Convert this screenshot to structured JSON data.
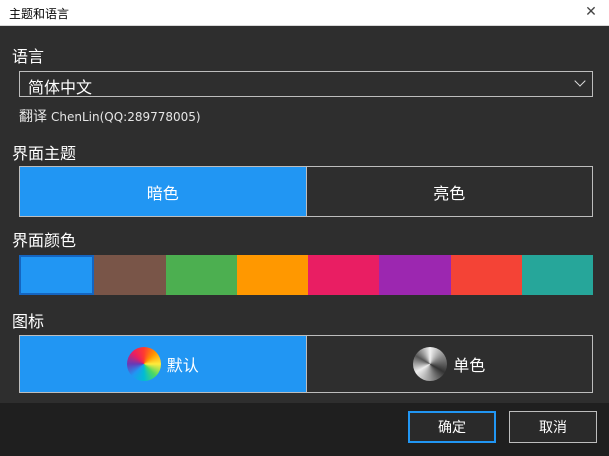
{
  "window": {
    "title": "主题和语言",
    "close": "✕"
  },
  "language": {
    "label": "语言",
    "selected": "简体中文",
    "translator_prefix": "翻译",
    "translator": "ChenLin(QQ:289778005)"
  },
  "theme": {
    "label": "界面主题",
    "options": [
      "暗色",
      "亮色"
    ],
    "selected_index": 0
  },
  "color": {
    "label": "界面颜色",
    "swatches": [
      "#2196f3",
      "#795548",
      "#4caf50",
      "#ff9800",
      "#e91e63",
      "#9c27b0",
      "#f44336",
      "#26a69a"
    ],
    "selected_index": 0
  },
  "icon": {
    "label": "图标",
    "options": [
      "默认",
      "单色"
    ],
    "selected_index": 0,
    "option_icons": [
      "color-wheel-icon",
      "mono-wheel-icon"
    ]
  },
  "footer": {
    "ok": "确定",
    "cancel": "取消"
  },
  "colors": {
    "accent": "#2196f3",
    "background": "#2e2e2e"
  }
}
